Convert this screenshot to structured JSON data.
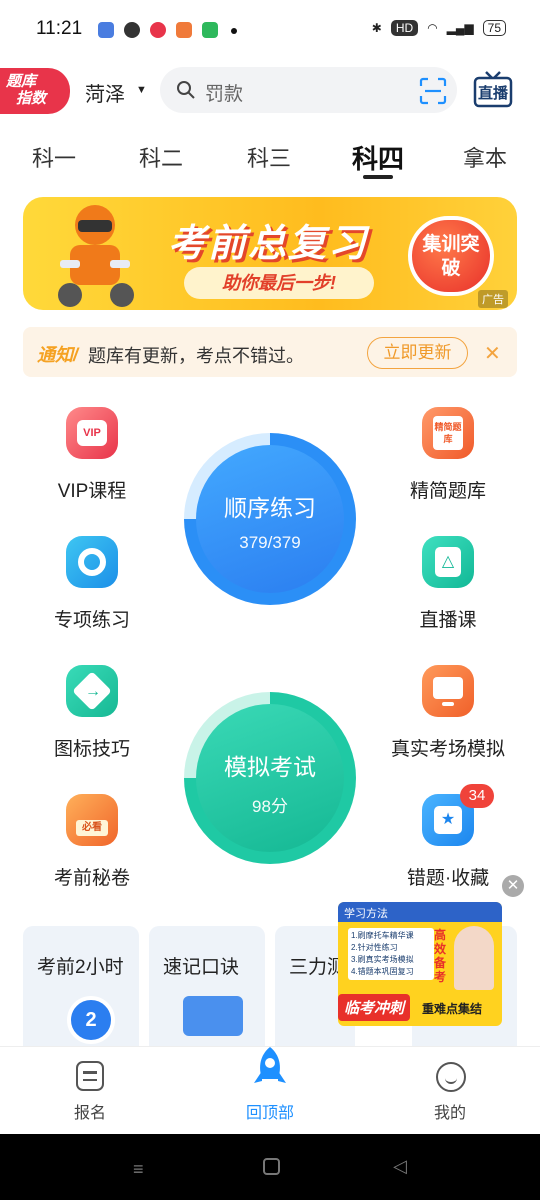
{
  "status_bar": {
    "time": "11:21",
    "battery": "75",
    "hd": "HD"
  },
  "header": {
    "logo_line1": "题库",
    "logo_line2": "指数",
    "city": "菏泽",
    "search_placeholder": "罚款",
    "live_label": "直播"
  },
  "tabs": [
    {
      "label": "科一"
    },
    {
      "label": "科二"
    },
    {
      "label": "科三"
    },
    {
      "label": "科四"
    },
    {
      "label": "拿本"
    }
  ],
  "banner": {
    "title": "考前总复习",
    "subtitle": "助你最后一步!",
    "badge": "集训突破",
    "ad_tag": "广告"
  },
  "notice": {
    "tag": "通知/",
    "text": "题库有更新，考点不错过。",
    "button": "立即更新"
  },
  "grid": {
    "left": [
      {
        "label": "VIP课程"
      },
      {
        "label": "专项练习"
      },
      {
        "label": "图标技巧"
      },
      {
        "label": "考前秘卷"
      }
    ],
    "right": [
      {
        "label": "精简题库"
      },
      {
        "label": "直播课"
      },
      {
        "label": "真实考场模拟"
      },
      {
        "label": "错题·收藏",
        "badge": "34"
      }
    ],
    "practice": {
      "title": "顺序练习",
      "progress": "379/379"
    },
    "exam": {
      "title": "模拟考试",
      "score": "98分"
    },
    "icon_texts": {
      "vip": "VIP",
      "jingjian": "精简题库",
      "mijuan": "必看"
    }
  },
  "cards": [
    {
      "label": "考前2小时"
    },
    {
      "label": "速记口诀"
    },
    {
      "label": "三力测"
    }
  ],
  "float_ad": {
    "header": "学习方法",
    "line1": "1.刷摩托车精华课",
    "line2": "2.针对性练习",
    "line3": "3.刷真实考场模拟",
    "line4": "4.错题本巩固复习",
    "side": "高效备考",
    "tag1": "临考冲刺",
    "tag2": "重难点集结"
  },
  "bottom_nav": [
    {
      "label": "报名"
    },
    {
      "label": "回顶部"
    },
    {
      "label": "我的"
    }
  ],
  "colors": {
    "accent": "#1e90ff",
    "logo": "#e8344a",
    "practice": "#2b8ff6",
    "exam": "#1fc9a4",
    "notice": "#f5a223"
  }
}
